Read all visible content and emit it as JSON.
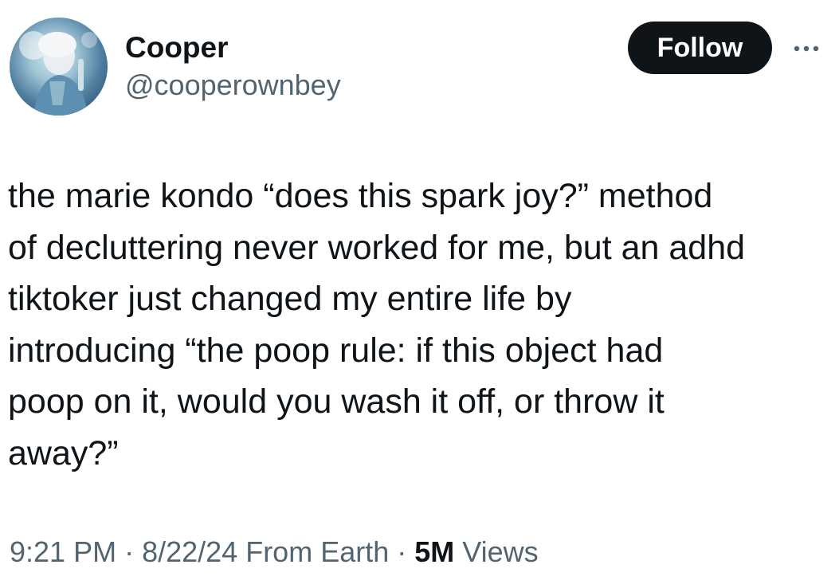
{
  "author": {
    "display_name": "Cooper",
    "handle": "@cooperownbey",
    "avatar_icon": "profile-photo"
  },
  "actions": {
    "follow_label": "Follow",
    "more_icon": "more-dots-icon"
  },
  "tweet": {
    "lines": [
      "the marie kondo “does this spark joy?” method",
      "of decluttering never worked for me, but an adhd",
      "tiktoker just changed my entire life by",
      "introducing “the poop rule: if this object had",
      "poop on it, would you wash it off, or throw it",
      "away?”"
    ]
  },
  "meta": {
    "time": "9:21 PM",
    "separator": " · ",
    "date": "8/22/24",
    "location": " From Earth",
    "views_count": "5M",
    "views_label": " Views"
  },
  "colors": {
    "text_primary": "#0f1419",
    "text_secondary": "#536471",
    "follow_bg": "#0f1419",
    "follow_text": "#ffffff"
  }
}
